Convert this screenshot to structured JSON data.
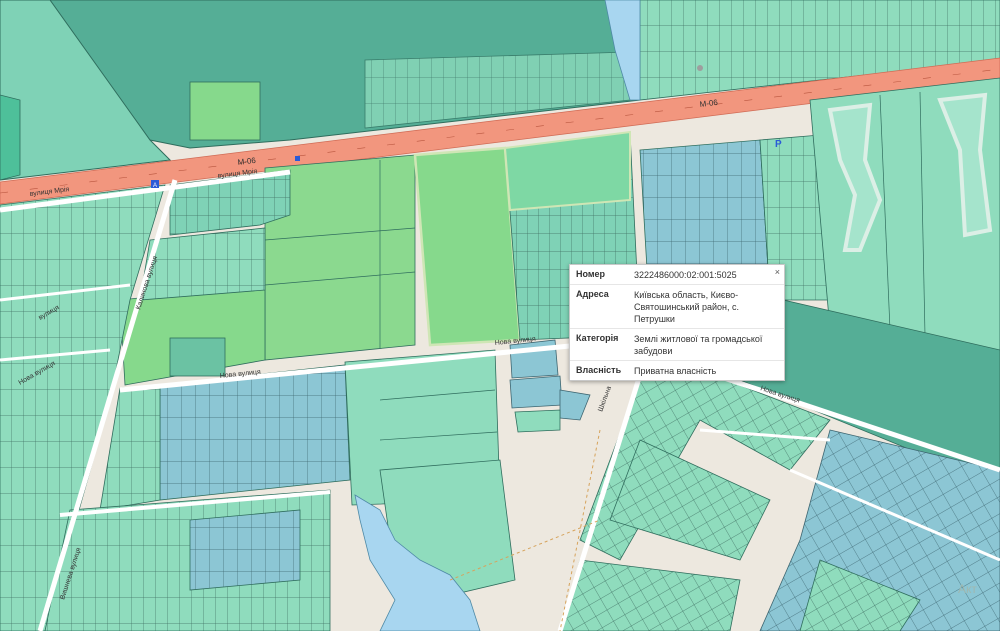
{
  "map": {
    "road_labels": {
      "m06_west": "M-06",
      "m06_east": "M-06",
      "mriia_street": "вулиця Мрія",
      "nova_street_west": "Нова вулиця",
      "nova_street_mid": "Нова вулиця",
      "nova_street_east": "Нова вулиця",
      "shkilna_street": "Шкільна",
      "vertical_street": "Калинова вулиця",
      "vertical_street_lower": "Вишнева вулиця",
      "west_street_1": "вулиця",
      "west_street_2": "Нова вулиця"
    },
    "watermark": "Акт",
    "colors": {
      "background": "#ede8df",
      "parcel_green": "#8fdcbd",
      "parcel_blue": "#8fc8d6",
      "forest": "#55ae96",
      "road_main": "#f2967e",
      "road_minor": "#ffffff",
      "water": "#a8d6f0"
    },
    "icons": [
      "bus-stop-icon",
      "bus-stop-icon",
      "parking-icon",
      "info-icon"
    ]
  },
  "popup": {
    "close": "×",
    "rows": [
      {
        "label": "Номер",
        "value": "3222486000:02:001:5025"
      },
      {
        "label": "Адреса",
        "value": "Київська область, Києво-Святошинський район, с. Петрушки"
      },
      {
        "label": "Категорія",
        "value": "Землі житлової та громадської забудови"
      },
      {
        "label": "Власність",
        "value": "Приватна власність"
      }
    ]
  }
}
